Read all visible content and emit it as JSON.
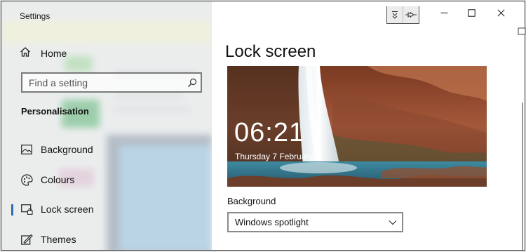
{
  "window": {
    "title": "Settings"
  },
  "nav": {
    "home_label": "Home",
    "search_placeholder": "Find a setting",
    "section_title": "Personalisation",
    "items": [
      {
        "label": "Background",
        "icon": "picture-icon",
        "selected": false
      },
      {
        "label": "Colours",
        "icon": "palette-icon",
        "selected": false
      },
      {
        "label": "Lock screen",
        "icon": "lock-screen-icon",
        "selected": true
      },
      {
        "label": "Themes",
        "icon": "themes-icon",
        "selected": false
      }
    ]
  },
  "content": {
    "page_title": "Lock screen",
    "preview": {
      "time": "06:21",
      "date": "Thursday 7 February"
    },
    "background_label": "Background",
    "background_value": "Windows spotlight"
  },
  "titlebar": {
    "controls": [
      "minimize-icon",
      "maximize-icon",
      "close-icon"
    ],
    "extra_tools": [
      "expand-down-icon",
      "plug-icon"
    ]
  },
  "colors": {
    "accent": "#2b6cb5",
    "nav_pane": "#e9ecec",
    "content_bg": "#ffffff"
  }
}
